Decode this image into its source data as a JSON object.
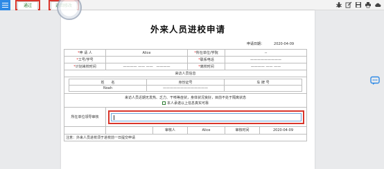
{
  "toolbar": {
    "pass_label": "通过",
    "return_label": "退回修改",
    "icons": [
      "bug-icon",
      "edit-icon",
      "save-icon",
      "print-icon",
      "cloud-icon"
    ]
  },
  "form": {
    "title": "外来人员进校申请",
    "apply_date_label": "申请日期：",
    "apply_date": "2020-04-09",
    "name_label": "申 请 人",
    "name_value": "Alice",
    "unit_label": "所在单位/学院",
    "unit_value": "--",
    "staff_id_label": "工号/学号",
    "staff_id_value": "",
    "phone_label": "联系电话",
    "phone_value": "—————————",
    "plan_time_label": "计划来校时间",
    "plan_time_from": "———— —— ——",
    "plan_time_to": "————",
    "leave_time_label": "离校时间",
    "leave_time_value": "———— —— ——",
    "visitor_section": "来访人员信息",
    "col_name": "姓　　名",
    "col_id": "身份证号",
    "col_plate": "车 牌 号",
    "visitor_name": "Noah",
    "visitor_id": "—————————————",
    "visitor_plate": "",
    "health_notice": "来访人员近期无发热、乏力、干咳等症状，身体状况良好，目前不处于隔离状态",
    "commitment": "本人承诺以上信息真实可靠",
    "leader_review_label": "所在单位领导审核",
    "reviewer_label": "审核人",
    "reviewer_value": "Alice",
    "review_time_label": "审核时间",
    "review_time_value": "2020-04-09",
    "footer_note": "注意：外来人员进校须于进校前一日提交申请"
  },
  "colors": {
    "accent": "#2e8ae6",
    "highlight": "#d9352b",
    "required": "#e02020"
  }
}
